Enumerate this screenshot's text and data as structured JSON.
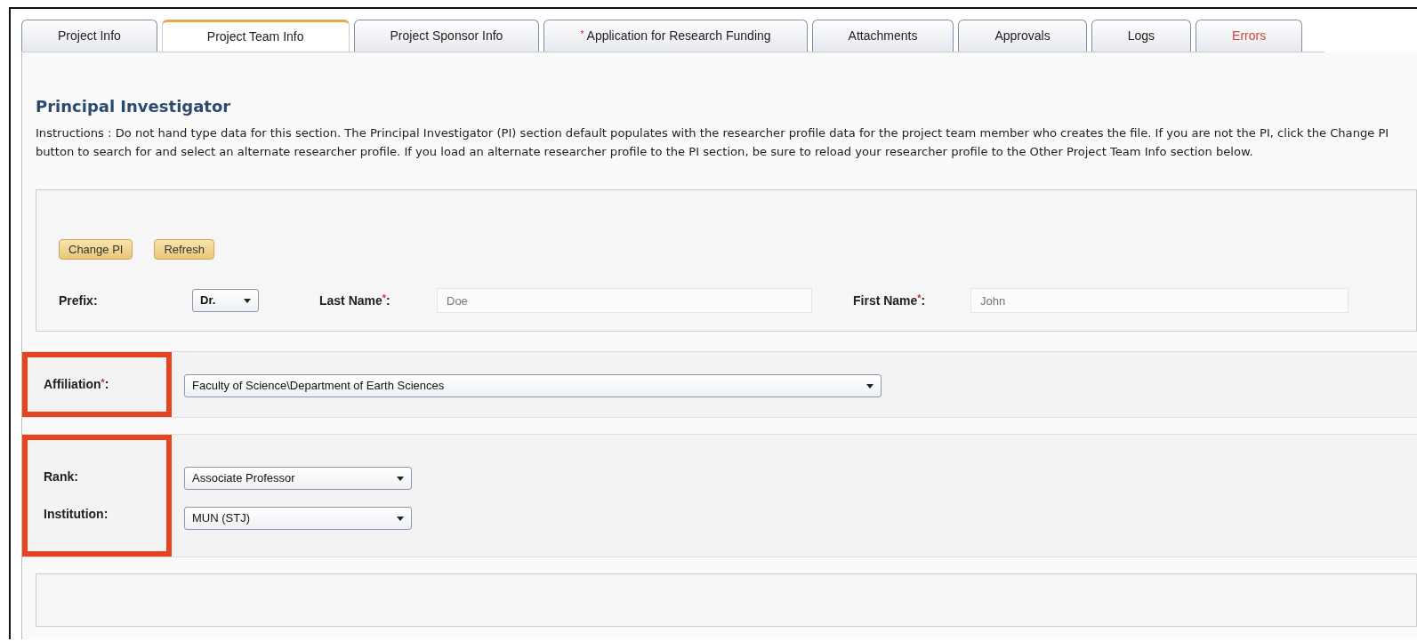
{
  "tabs": [
    {
      "label": "Project Info",
      "selected": false,
      "alert": false
    },
    {
      "label": "Project Team Info",
      "selected": true,
      "alert": false
    },
    {
      "label": "Project Sponsor Info",
      "selected": false,
      "alert": false
    },
    {
      "label": "$^{*}$ Application for Research Funding",
      "selected": false,
      "alert": false
    },
    {
      "label": "Attachments",
      "selected": false,
      "alert": false
    },
    {
      "label": "Approvals",
      "selected": false,
      "alert": false
    },
    {
      "label": "Logs",
      "selected": false,
      "alert": false
    },
    {
      "label": "Errors",
      "selected": false,
      "alert": true
    }
  ],
  "section": {
    "title": "Principal Investigator",
    "instructions": "Instructions : Do not hand type data for this section. The Principal Investigator (PI) section default populates with the researcher profile data for the project team member who creates the file. If you are not the PI, click the Change PI button to search for and select an alternate researcher profile. If you load an alternate researcher profile to the PI section, be sure to reload your researcher profile to the Other Project Team Info section below."
  },
  "name_panel": {
    "buttons": [
      "Change PI",
      "Refresh"
    ],
    "prefix": {
      "label": "Prefix:",
      "value": "Dr."
    },
    "last_name": {
      "label": "Last Name$^{*}$:",
      "value": "Doe"
    },
    "first_name": {
      "label": "First Name$^{*}$:",
      "value": "John"
    }
  },
  "affiliation_panel": {
    "highlighted": true,
    "fields": [
      {
        "label": "Affiliation$^{*}$:",
        "value": "Faculty of Science\\Department of Earth Sciences"
      }
    ]
  },
  "rank_panel": {
    "highlighted": true,
    "fields": [
      {
        "label": "Rank:",
        "value": "Associate Professor"
      },
      {
        "label": "Institution:",
        "value": "MUN (STJ)"
      }
    ]
  }
}
